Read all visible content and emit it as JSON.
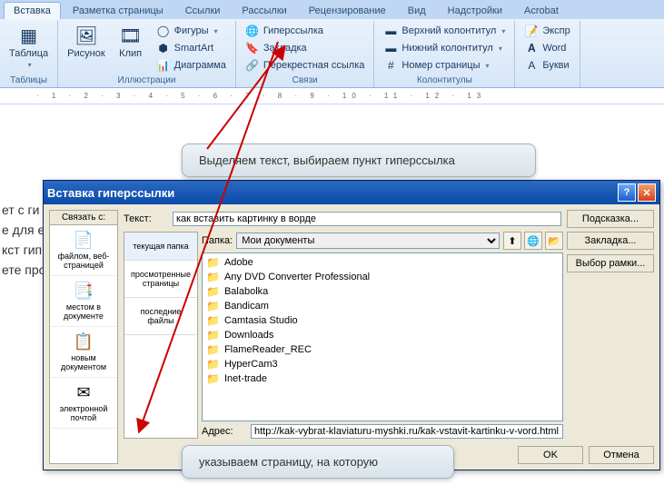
{
  "ribbon": {
    "tabs": [
      "Вставка",
      "Разметка страницы",
      "Ссылки",
      "Рассылки",
      "Рецензирование",
      "Вид",
      "Надстройки",
      "Acrobat"
    ],
    "groups": {
      "tables": {
        "label": "Таблицы",
        "table_btn": "Таблица"
      },
      "illus": {
        "label": "Иллюстрации",
        "picture": "Рисунок",
        "clip": "Клип",
        "shapes": "Фигуры",
        "smartart": "SmartArt",
        "chart": "Диаграмма"
      },
      "links": {
        "label": "Связи",
        "hyperlink": "Гиперссылка",
        "bookmark": "Закладка",
        "crossref": "Перекрестная ссылка"
      },
      "headers": {
        "label": "Колонтитулы",
        "header": "Верхний колонтитул",
        "footer": "Нижний колонтитул",
        "pagenum": "Номер страницы"
      },
      "text": {
        "express": "Экспр",
        "wordart": "Word",
        "dropcap": "Букви"
      }
    }
  },
  "callout1": "Выделяем текст, выбираем пункт гиперссылка",
  "callout2": "указываем страницу, на которую",
  "doc_lines": [
    "ет с ги",
    "е для ес",
    "кст гип",
    "ете про"
  ],
  "dialog": {
    "title": "Вставка гиперссылки",
    "link_to_label": "Связать с:",
    "link_items": [
      {
        "icon": "📄",
        "label": "файлом, веб-страницей"
      },
      {
        "icon": "📑",
        "label": "местом в документе"
      },
      {
        "icon": "📋",
        "label": "новым документом"
      },
      {
        "icon": "✉",
        "label": "электронной почтой"
      }
    ],
    "text_label": "Текст:",
    "text_value": "как вставить картинку в ворде",
    "folder_label": "Папка:",
    "folder_value": "Мои документы",
    "view_tabs": [
      "текущая папка",
      "просмотренные страницы",
      "последние файлы"
    ],
    "files": [
      "Adobe",
      "Any DVD Converter Professional",
      "Balabolka",
      "Bandicam",
      "Camtasia Studio",
      "Downloads",
      "FlameReader_REC",
      "HyperCam3",
      "Inet-trade"
    ],
    "addr_label": "Адрес:",
    "addr_value": "http://kak-vybrat-klaviaturu-myshki.ru/kak-vstavit-kartinku-v-vord.html",
    "btns": {
      "hint": "Подсказка...",
      "bookmark": "Закладка...",
      "frame": "Выбор рамки...",
      "ok": "OK",
      "cancel": "Отмена"
    }
  }
}
